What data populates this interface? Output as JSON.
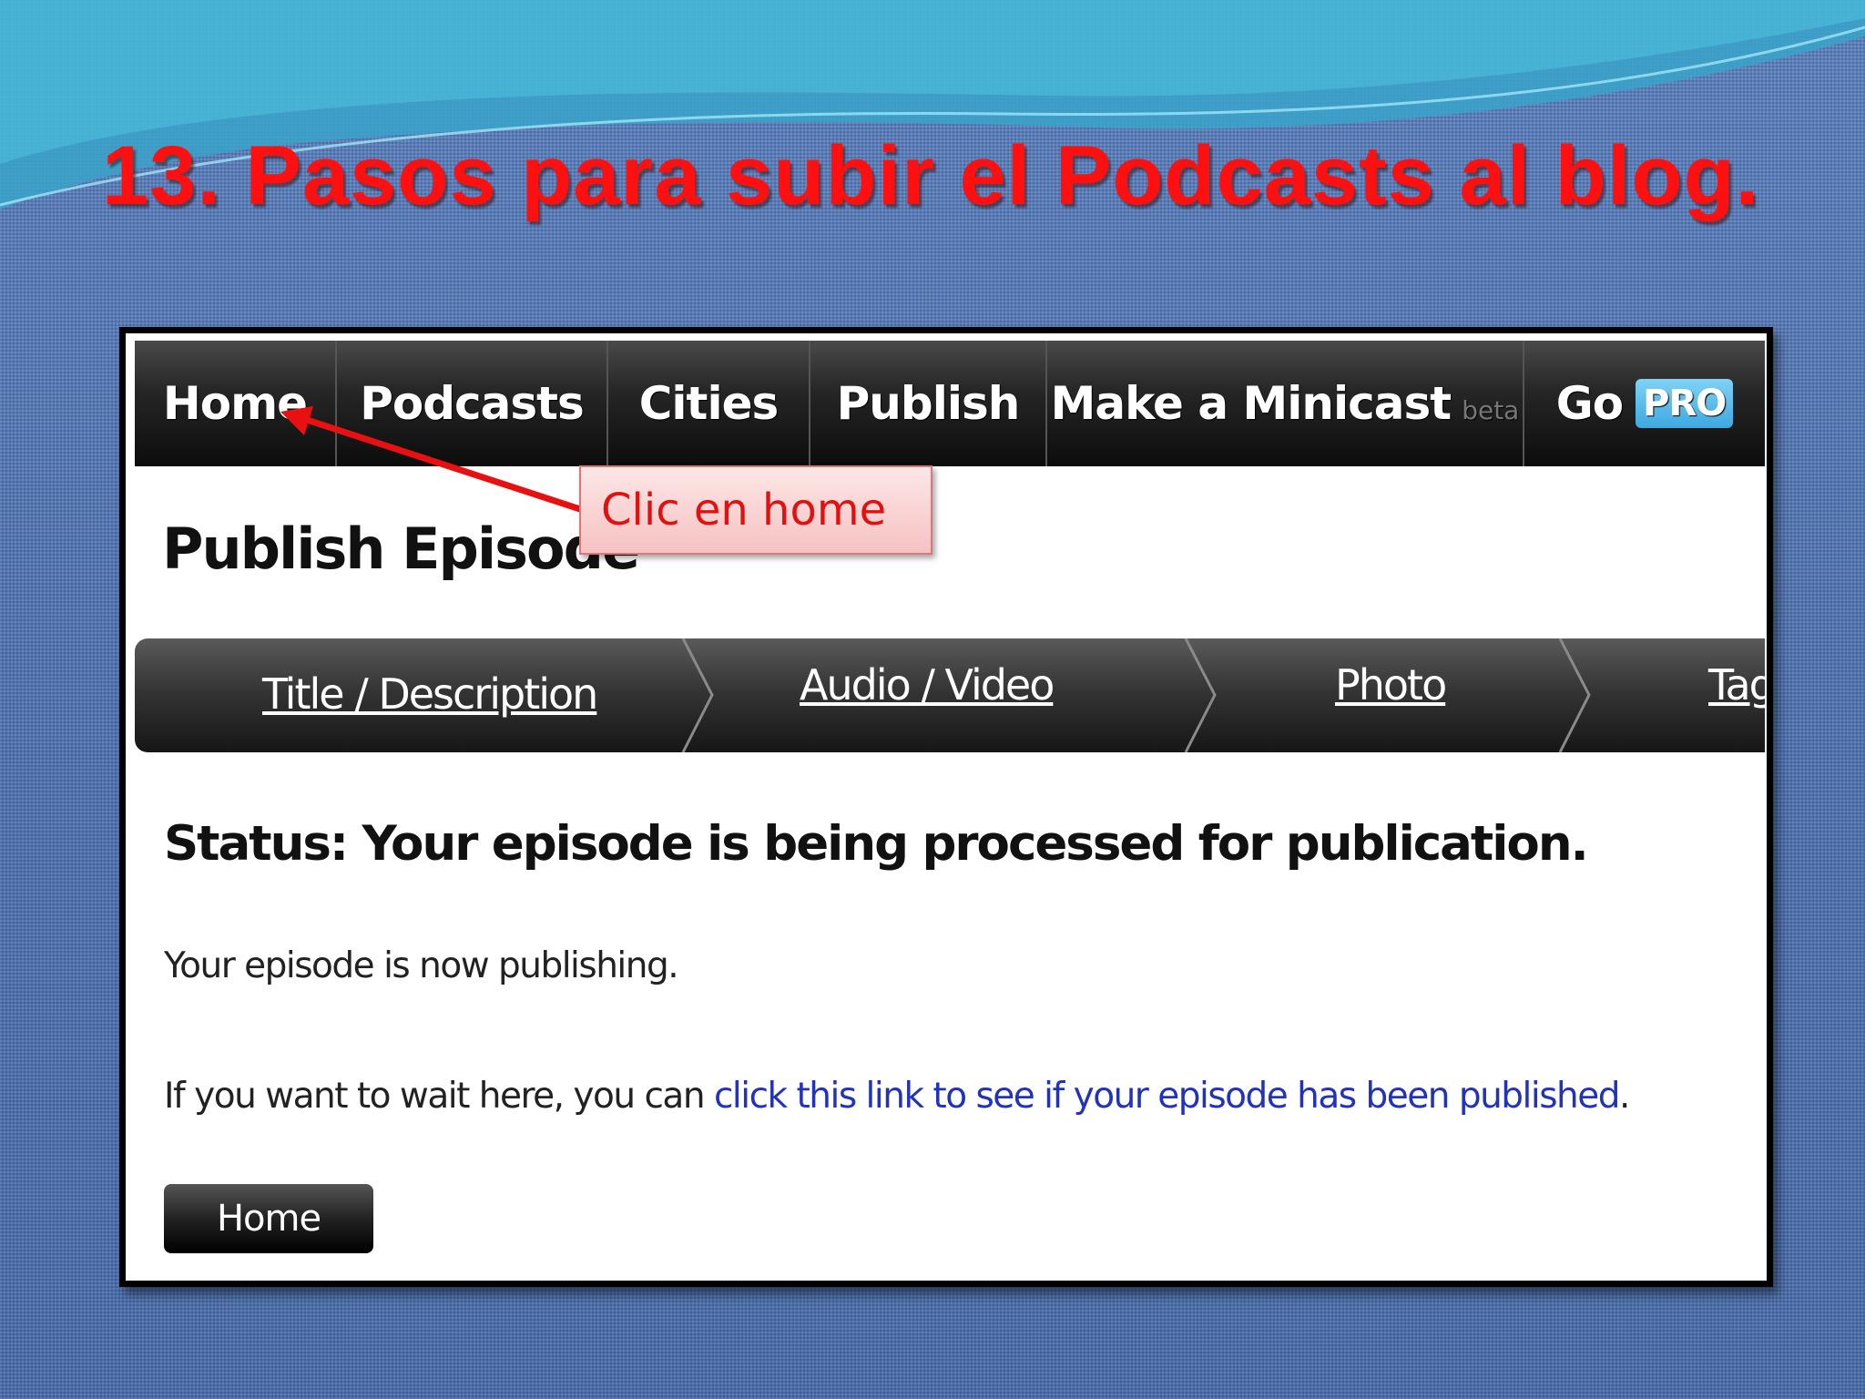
{
  "slide": {
    "title": "13. Pasos para  subir el Podcasts al blog."
  },
  "topnav": {
    "items": [
      {
        "label": "Home"
      },
      {
        "label": "Podcasts"
      },
      {
        "label": "Cities"
      },
      {
        "label": "Publish"
      },
      {
        "label": "Make a Minicast",
        "suffix": "beta"
      },
      {
        "label": "Go",
        "badge": "PRO"
      }
    ]
  },
  "page": {
    "title": "Publish Episode",
    "steps": [
      "Title / Description",
      "Audio / Video",
      "Photo",
      "Tag"
    ],
    "status": "Status: Your episode is being processed for publication.",
    "message": "Your episode is now publishing.",
    "wait_prefix": "If you want to wait here, you can ",
    "wait_link": "click this link to see if your episode has been published",
    "wait_suffix": ".",
    "home_button": "Home"
  },
  "callout": {
    "text": "Clic en home"
  },
  "colors": {
    "title_red": "#ff1010",
    "callout_text": "#e31010",
    "link_blue": "#2233bb",
    "pro_blue": "#3ea8e0"
  }
}
